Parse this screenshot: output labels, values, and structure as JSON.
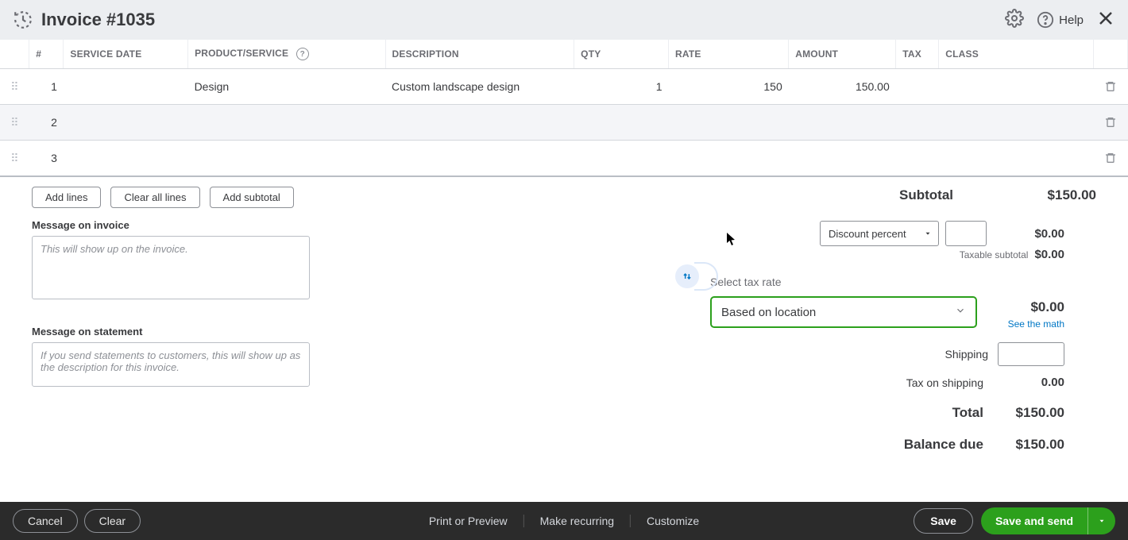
{
  "header": {
    "title": "Invoice #1035",
    "help_label": "Help"
  },
  "table": {
    "headers": {
      "num": "#",
      "service_date": "SERVICE DATE",
      "product": "PRODUCT/SERVICE",
      "description": "DESCRIPTION",
      "qty": "QTY",
      "rate": "RATE",
      "amount": "AMOUNT",
      "tax": "TAX",
      "class": "CLASS"
    },
    "rows": [
      {
        "num": "1",
        "service_date": "",
        "product": "Design",
        "description": "Custom landscape design",
        "qty": "1",
        "rate": "150",
        "amount": "150.00",
        "tax": "",
        "class": ""
      },
      {
        "num": "2",
        "service_date": "",
        "product": "",
        "description": "",
        "qty": "",
        "rate": "",
        "amount": "",
        "tax": "",
        "class": ""
      },
      {
        "num": "3",
        "service_date": "",
        "product": "",
        "description": "",
        "qty": "",
        "rate": "",
        "amount": "",
        "tax": "",
        "class": ""
      }
    ]
  },
  "actions": {
    "add_lines": "Add lines",
    "clear_all": "Clear all lines",
    "add_subtotal": "Add subtotal"
  },
  "messages": {
    "invoice_label": "Message on invoice",
    "invoice_placeholder": "This will show up on the invoice.",
    "statement_label": "Message on statement",
    "statement_placeholder": "If you send statements to customers, this will show up as the description for this invoice."
  },
  "summary": {
    "subtotal_label": "Subtotal",
    "subtotal_value": "$150.00",
    "discount_select": "Discount percent",
    "discount_value": "$0.00",
    "taxable_subtotal_label": "Taxable subtotal",
    "taxable_subtotal_value": "$0.00",
    "select_tax_label": "Select tax rate",
    "tax_select_value": "Based on location",
    "tax_value": "$0.00",
    "see_math": "See the math",
    "shipping_label": "Shipping",
    "tax_on_shipping_label": "Tax on shipping",
    "tax_on_shipping_value": "0.00",
    "total_label": "Total",
    "total_value": "$150.00",
    "balance_due_label": "Balance due",
    "balance_due_value": "$150.00"
  },
  "footer": {
    "cancel": "Cancel",
    "clear": "Clear",
    "print": "Print or Preview",
    "recurring": "Make recurring",
    "customize": "Customize",
    "save": "Save",
    "save_send": "Save and send"
  }
}
